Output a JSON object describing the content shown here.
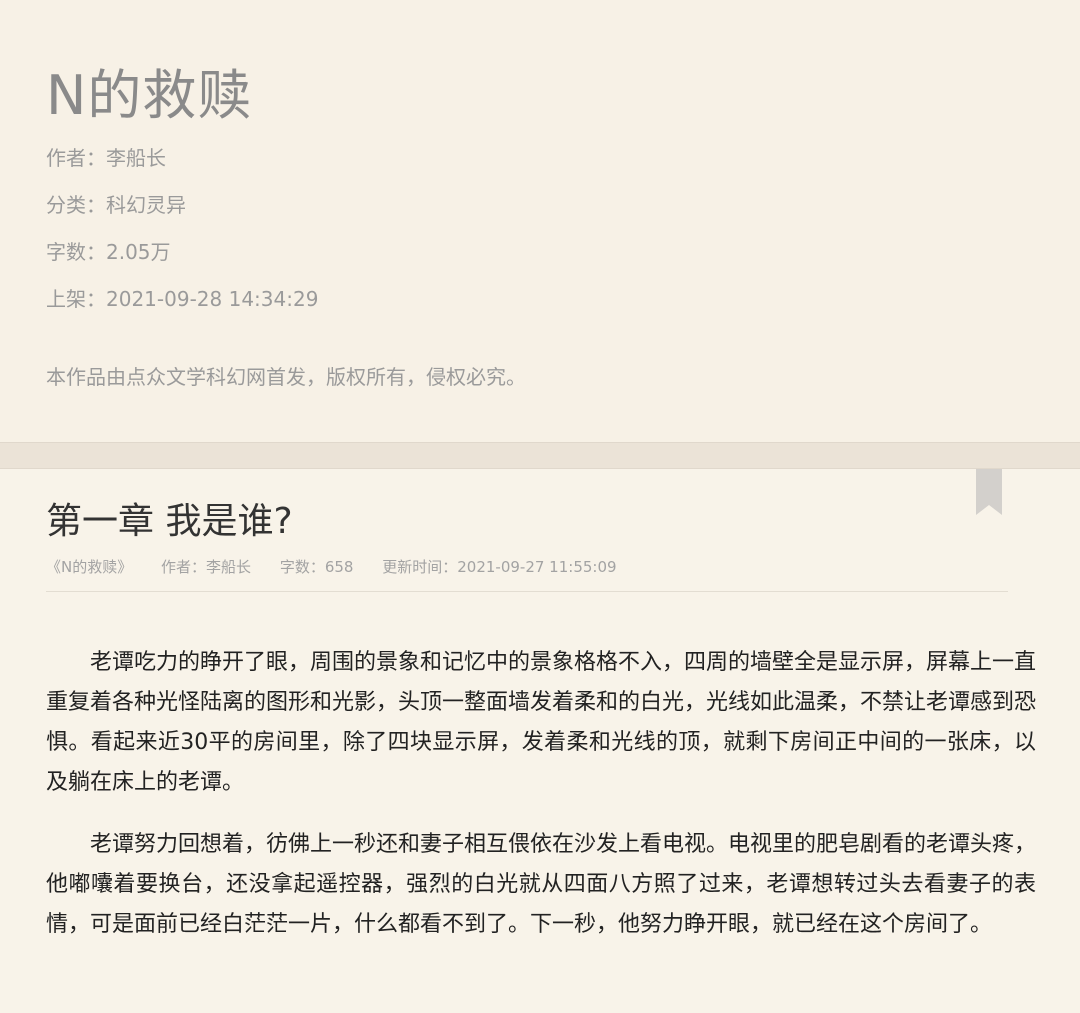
{
  "book": {
    "title": "N的救赎",
    "author_label": "作者：",
    "author": "李船长",
    "category_label": "分类：",
    "category": "科幻灵异",
    "word_count_label": "字数：",
    "word_count": "2.05万",
    "release_label": "上架：",
    "release_time": "2021-09-28 14:34:29",
    "copyright": "本作品由点众文学科幻网首发，版权所有，侵权必究。"
  },
  "chapter": {
    "title": "第一章 我是谁?",
    "meta": {
      "book_ref": "《N的救赎》",
      "author": "作者：李船长",
      "word_count": "字数：658",
      "updated": "更新时间：2021-09-27 11:55:09"
    },
    "paragraphs": [
      "老谭吃力的睁开了眼，周围的景象和记忆中的景象格格不入，四周的墙壁全是显示屏，屏幕上一直重复着各种光怪陆离的图形和光影，头顶一整面墙发着柔和的白光，光线如此温柔，不禁让老谭感到恐惧。看起来近30平的房间里，除了四块显示屏，发着柔和光线的顶，就剩下房间正中间的一张床，以及躺在床上的老谭。",
      "老谭努力回想着，彷佛上一秒还和妻子相互偎依在沙发上看电视。电视里的肥皂剧看的老谭头疼，他嘟囔着要换台，还没拿起遥控器，强烈的白光就从四面八方照了过来，老谭想转过头去看妻子的表情，可是面前已经白茫茫一片，什么都看不到了。下一秒，他努力睁开眼，就已经在这个房间了。"
    ]
  },
  "icons": {
    "bookmark": "bookmark-icon"
  },
  "colors": {
    "background": "#f7f1e6",
    "band": "#ebe3d7",
    "title_gray": "#8a8a8a",
    "meta_gray": "#9a9a9a",
    "body_text": "#222222",
    "bookmark": "#d3d0cc"
  }
}
